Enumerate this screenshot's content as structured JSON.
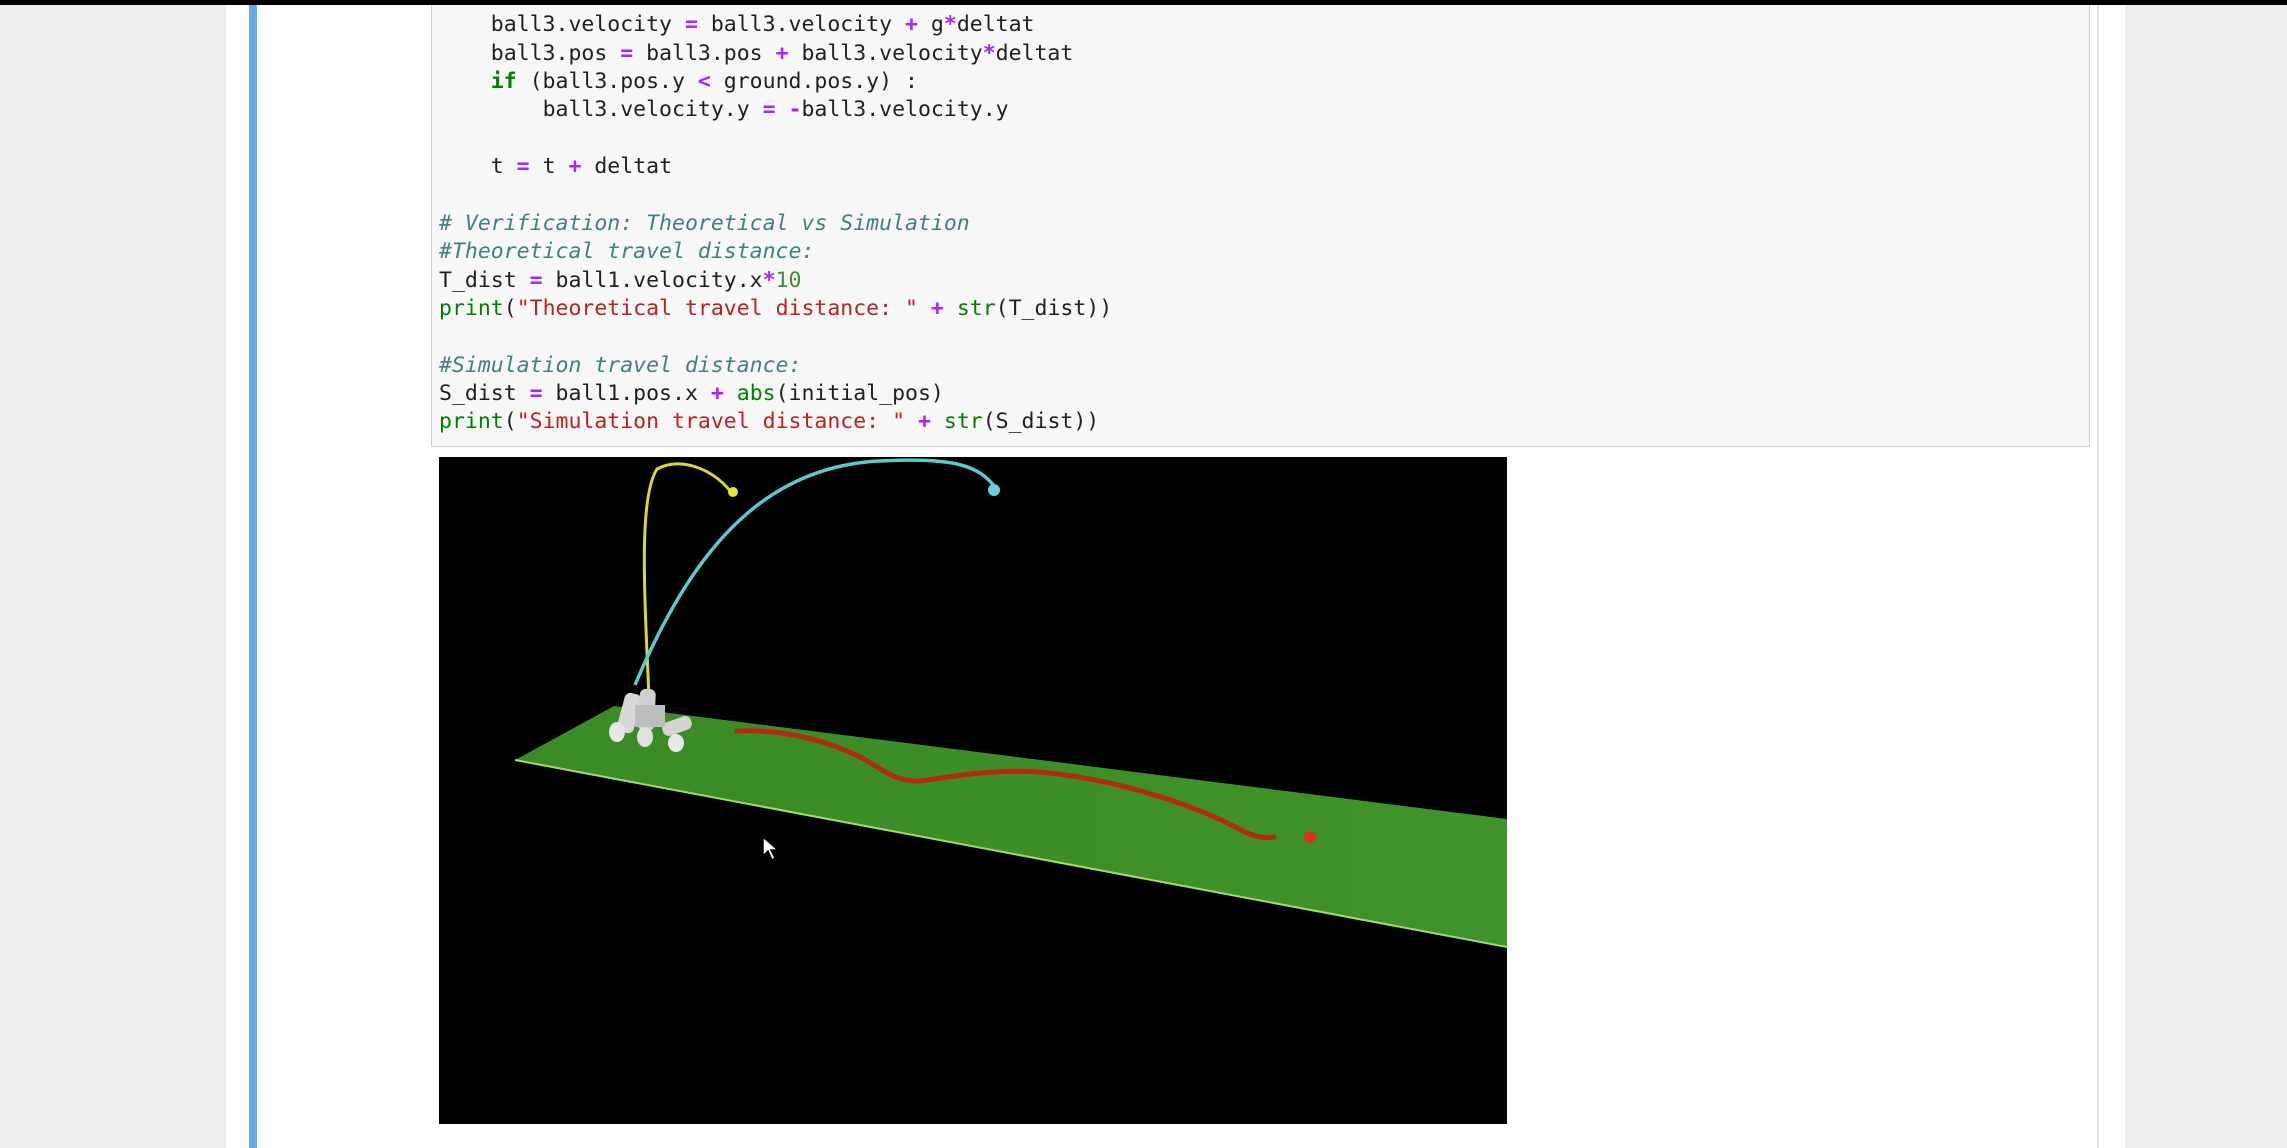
{
  "code": {
    "line1": [
      "ball3.velocity ",
      "=",
      " ball3.velocity ",
      "+",
      " g",
      "*",
      "deltat"
    ],
    "line2": [
      "ball3.pos ",
      "=",
      " ball3.pos ",
      "+",
      " ball3.velocity",
      "*",
      "deltat"
    ],
    "line3": [
      "if",
      " (ball3.pos.y ",
      "<",
      " ground.pos.y) :"
    ],
    "line4": [
      "ball3.velocity.y ",
      "=",
      " ",
      "-",
      "ball3.velocity.y"
    ],
    "line5": [
      "t ",
      "=",
      " t ",
      "+",
      " deltat"
    ],
    "line6": "# Verification: Theoretical vs Simulation",
    "line7": "#Theoretical travel distance:",
    "line8": [
      "T_dist ",
      "=",
      " ball1.velocity.x",
      "*",
      "10"
    ],
    "line9": [
      "print",
      "(",
      "\"Theoretical travel distance: \"",
      " ",
      "+",
      " ",
      "str",
      "(T_dist))"
    ],
    "line10": "#Simulation travel distance:",
    "line11": [
      "S_dist ",
      "=",
      " ball1.pos.x ",
      "+",
      " ",
      "abs",
      "(initial_pos)"
    ],
    "line12": [
      "print",
      "(",
      "\"Simulation travel distance: \"",
      " ",
      "+",
      " ",
      "str",
      "(S_dist))"
    ]
  },
  "colors": {
    "background": "#000000",
    "ground": "#3e8e28",
    "ball1_trail": "#b22a12",
    "ball2_trail": "#d8d83a",
    "ball3_trail": "#5cc8d0",
    "cell_selected_bar": "#66a9e8"
  },
  "icons": {
    "cursor": "mouse-pointer-icon"
  }
}
